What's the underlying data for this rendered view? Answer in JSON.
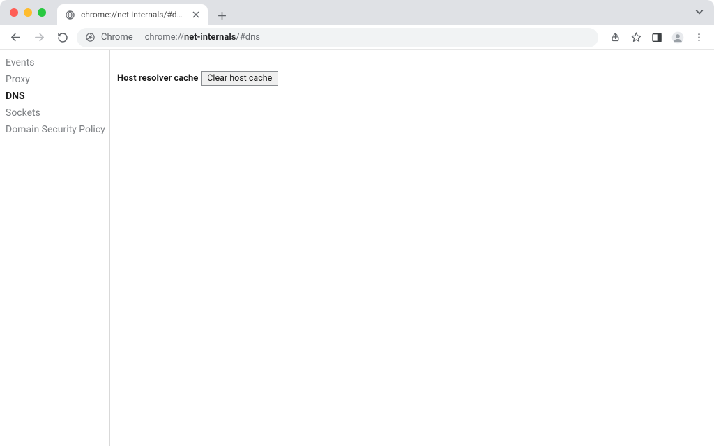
{
  "tab": {
    "title": "chrome://net-internals/#dns"
  },
  "addressbar": {
    "scheme_label": "Chrome",
    "url_prefix": "chrome://",
    "url_bold": "net-internals",
    "url_suffix": "/#dns"
  },
  "sidebar": {
    "items": [
      {
        "label": "Events",
        "active": false
      },
      {
        "label": "Proxy",
        "active": false
      },
      {
        "label": "DNS",
        "active": true
      },
      {
        "label": "Sockets",
        "active": false
      },
      {
        "label": "Domain Security Policy",
        "active": false
      }
    ]
  },
  "main": {
    "resolver_label": "Host resolver cache",
    "clear_button": "Clear host cache"
  }
}
